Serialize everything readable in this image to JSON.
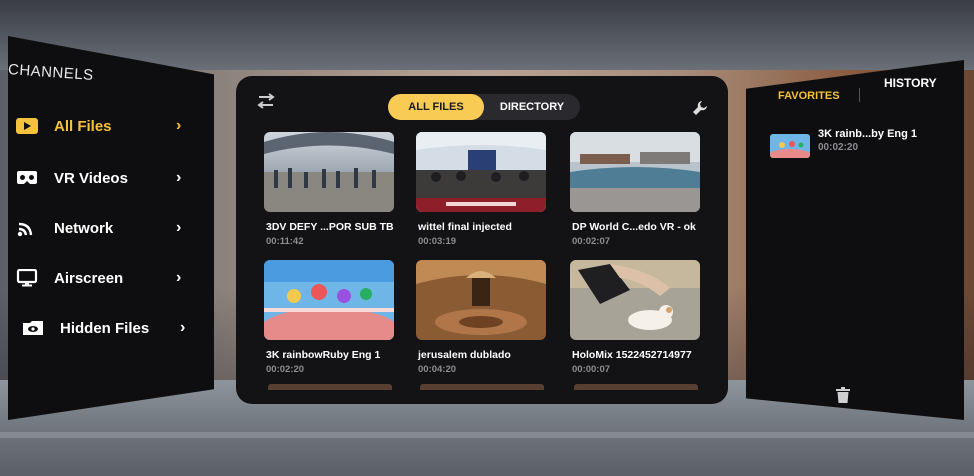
{
  "channels": {
    "title": "CHANNELS",
    "items": [
      {
        "label": "All Files",
        "icon": "play-icon",
        "active": true
      },
      {
        "label": "VR Videos",
        "icon": "vr-headset-icon",
        "active": false
      },
      {
        "label": "Network",
        "icon": "wifi-icon",
        "active": false
      },
      {
        "label": "Airscreen",
        "icon": "monitor-icon",
        "active": false
      },
      {
        "label": "Hidden Files",
        "icon": "hidden-eye-icon",
        "active": false
      }
    ],
    "chevron": "›"
  },
  "main": {
    "tabs": [
      {
        "label": "ALL FILES",
        "selected": true
      },
      {
        "label": "DIRECTORY",
        "selected": false
      }
    ],
    "files": [
      {
        "name": "3DV DEFY ...POR SUB TB",
        "duration": "00:11:42"
      },
      {
        "name": "wittel final injected",
        "duration": "00:03:19"
      },
      {
        "name": "DP World C...edo VR  - ok",
        "duration": "00:02:07"
      },
      {
        "name": "3K rainbowRuby Eng 1",
        "duration": "00:02:20"
      },
      {
        "name": "jerusalem dublado",
        "duration": "00:04:20"
      },
      {
        "name": "HoloMix 1522452714977",
        "duration": "00:00:07"
      }
    ]
  },
  "sidebar_right": {
    "tabs": {
      "favorites": "FAVORITES",
      "history": "HISTORY"
    },
    "items": [
      {
        "name": "3K rainb...by Eng 1",
        "duration": "00:02:20"
      }
    ]
  },
  "colors": {
    "accent": "#f4c23d",
    "panel": "#131315",
    "muted": "#8d8d92"
  }
}
